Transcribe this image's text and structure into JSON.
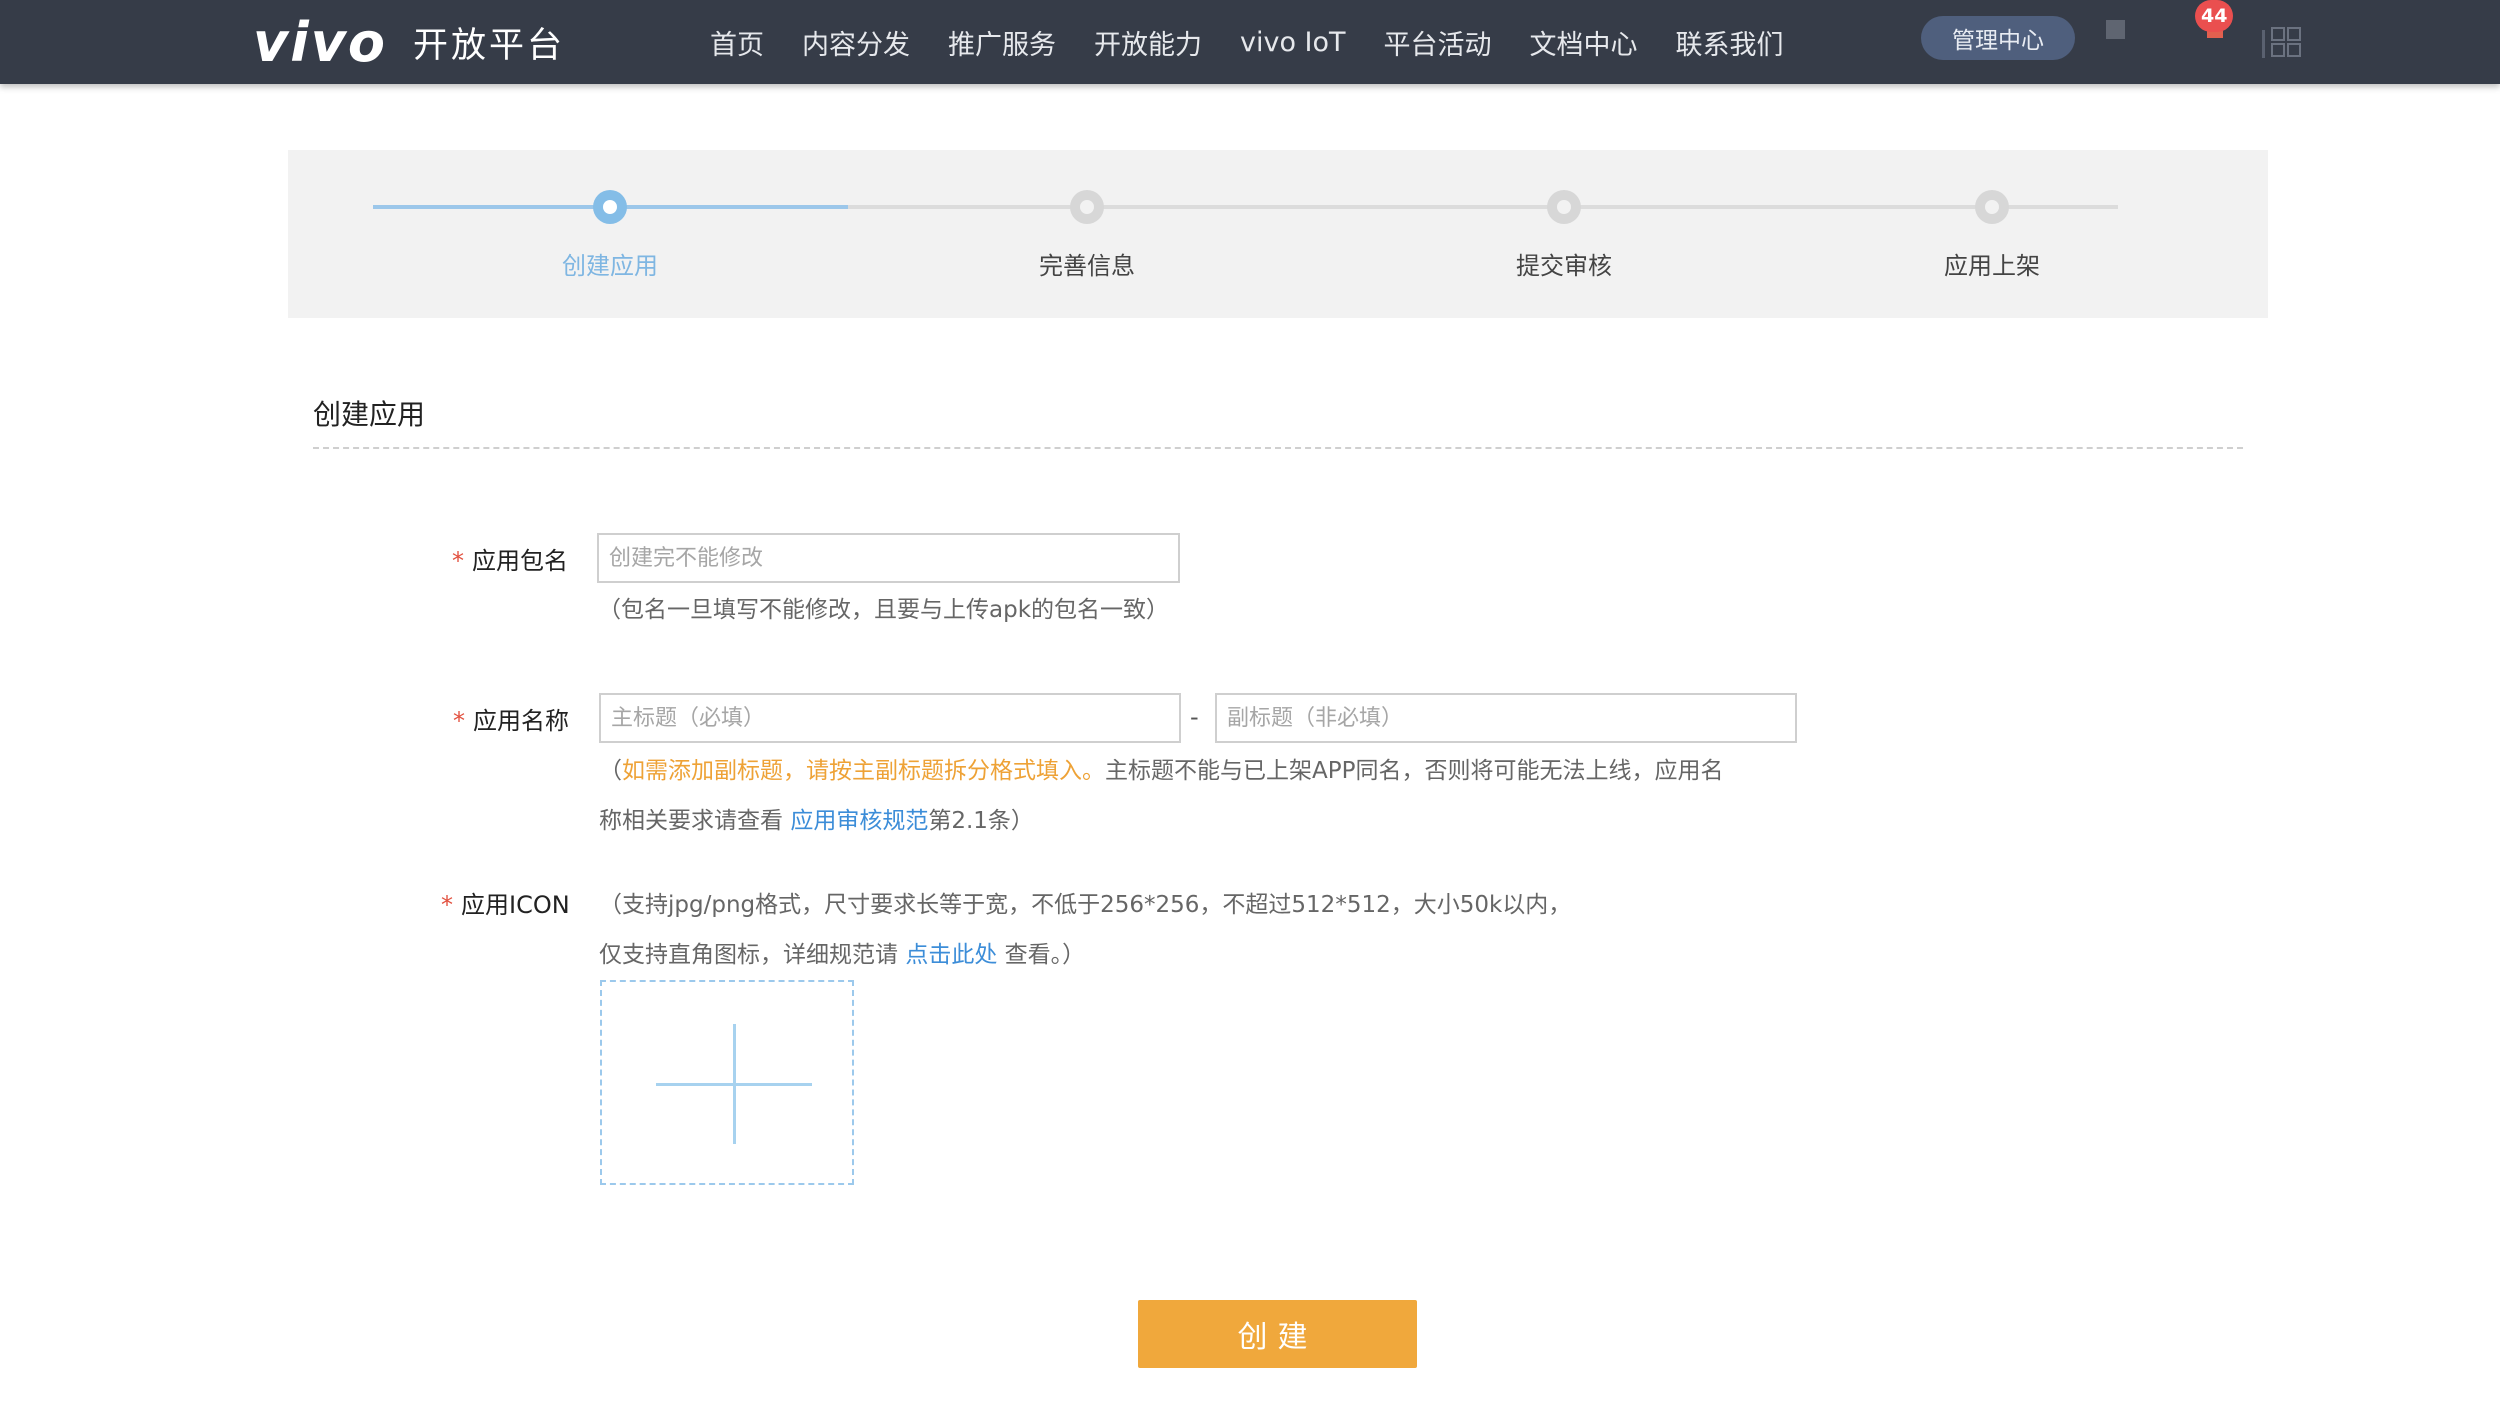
{
  "header": {
    "logo": "vivo",
    "brand_sub": "开放平台",
    "nav": [
      "首页",
      "内容分发",
      "推广服务",
      "开放能力",
      "vivo IoT",
      "平台活动",
      "文档中心",
      "联系我们"
    ],
    "mgmt_label": "管理中心",
    "badge_count": "44",
    "colors": {
      "bar": "#363c48",
      "mgmt": "#4f5f7d",
      "badge": "#ea4f4f"
    }
  },
  "steps": {
    "items": [
      "创建应用",
      "完善信息",
      "提交审核",
      "应用上架"
    ],
    "active_index": 0,
    "active_color": "#84bde7"
  },
  "form": {
    "section_title": "创建应用",
    "package": {
      "label": "应用包名",
      "placeholder": "创建完不能修改",
      "hint": "（包名一旦填写不能修改，且要与上传apk的包名一致）"
    },
    "app_name": {
      "label": "应用名称",
      "main_placeholder": "主标题（必填）",
      "separator": "-",
      "sub_placeholder": "副标题（非必填）",
      "hint_open": "（",
      "hint_orange": "如需添加副标题，请按主副标题拆分格式填入。",
      "hint_line1_rest": "主标题不能与已上架APP同名，否则将可能无法上线，应用名",
      "hint_line2_pre": "称相关要求请查看",
      "hint_link": "应用审核规范",
      "hint_line2_post": "第2.1条）"
    },
    "icon": {
      "label": "应用ICON",
      "hint_line1": "（支持jpg/png格式，尺寸要求长等于宽，不低于256*256，不超过512*512，大小50k以内，",
      "hint_line2_pre": "仅支持直角图标，详细规范请",
      "hint_link": "点击此处",
      "hint_line2_post": "查看。）"
    },
    "required_mark": "*",
    "submit_label": "创建",
    "submit_color": "#f0a83c"
  }
}
